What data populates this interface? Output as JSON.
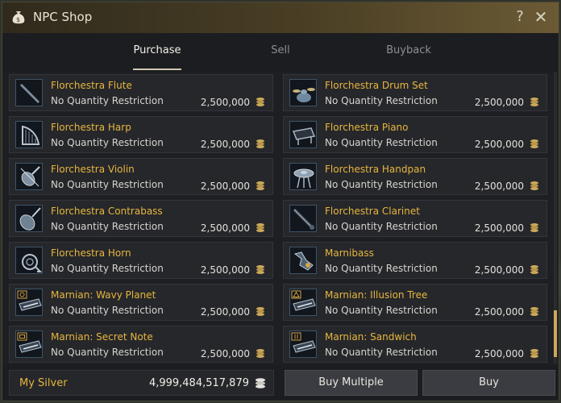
{
  "window": {
    "title": "NPC Shop",
    "help_icon": "?",
    "close_icon": "✕"
  },
  "tabs": [
    {
      "label": "Purchase",
      "active": true
    },
    {
      "label": "Sell",
      "active": false
    },
    {
      "label": "Buyback",
      "active": false
    }
  ],
  "items": [
    {
      "name": "Florchestra Flute",
      "restriction": "No Quantity Restriction",
      "price": "2,500,000",
      "icon": "flute-icon"
    },
    {
      "name": "Florchestra Drum Set",
      "restriction": "No Quantity Restriction",
      "price": "2,500,000",
      "icon": "drum-set-icon"
    },
    {
      "name": "Florchestra Harp",
      "restriction": "No Quantity Restriction",
      "price": "2,500,000",
      "icon": "harp-icon"
    },
    {
      "name": "Florchestra Piano",
      "restriction": "No Quantity Restriction",
      "price": "2,500,000",
      "icon": "piano-icon"
    },
    {
      "name": "Florchestra Violin",
      "restriction": "No Quantity Restriction",
      "price": "2,500,000",
      "icon": "violin-icon"
    },
    {
      "name": "Florchestra Handpan",
      "restriction": "No Quantity Restriction",
      "price": "2,500,000",
      "icon": "handpan-icon"
    },
    {
      "name": "Florchestra Contrabass",
      "restriction": "No Quantity Restriction",
      "price": "2,500,000",
      "icon": "contrabass-icon"
    },
    {
      "name": "Florchestra Clarinet",
      "restriction": "No Quantity Restriction",
      "price": "2,500,000",
      "icon": "clarinet-icon"
    },
    {
      "name": "Florchestra Horn",
      "restriction": "No Quantity Restriction",
      "price": "2,500,000",
      "icon": "horn-icon"
    },
    {
      "name": "Marnibass",
      "restriction": "No Quantity Restriction",
      "price": "2,500,000",
      "icon": "marnibass-icon"
    },
    {
      "name": "Marnian: Wavy Planet",
      "restriction": "No Quantity Restriction",
      "price": "2,500,000",
      "icon": "marnian-keyboard-icon"
    },
    {
      "name": "Marnian: Illusion Tree",
      "restriction": "No Quantity Restriction",
      "price": "2,500,000",
      "icon": "marnian-keyboard-icon"
    },
    {
      "name": "Marnian: Secret Note",
      "restriction": "No Quantity Restriction",
      "price": "2,500,000",
      "icon": "marnian-keyboard-icon"
    },
    {
      "name": "Marnian: Sandwich",
      "restriction": "No Quantity Restriction",
      "price": "2,500,000",
      "icon": "marnian-keyboard-icon"
    }
  ],
  "footer": {
    "silver_label": "My Silver",
    "silver_value": "4,999,484,517,879",
    "buy_multiple_label": "Buy Multiple",
    "buy_label": "Buy"
  },
  "colors": {
    "item_name": "#e6b63d",
    "accent_gold": "#c9a85a",
    "title_bar": "#4a3f25"
  }
}
